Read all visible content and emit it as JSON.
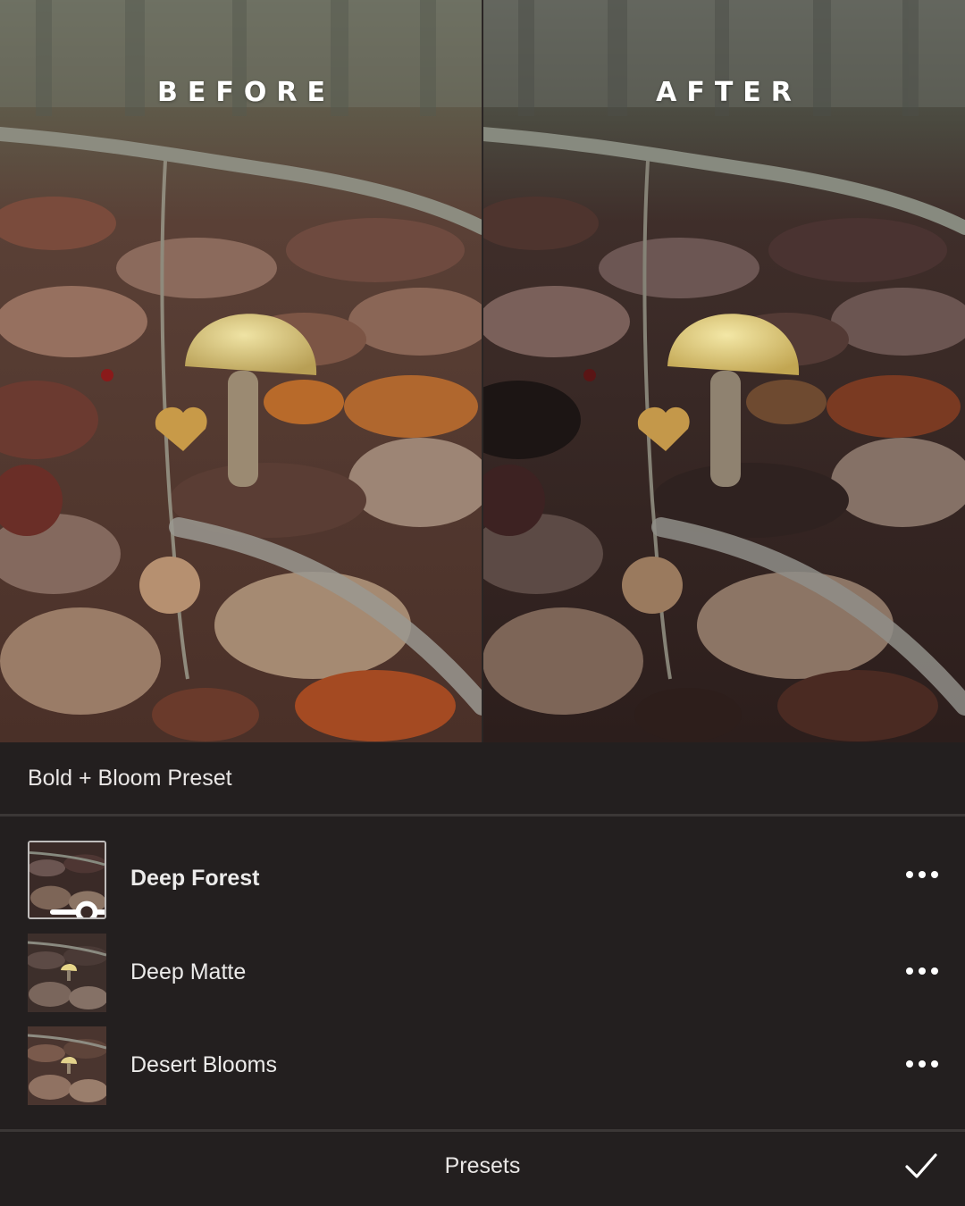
{
  "compare": {
    "before_label": "BEFORE",
    "after_label": "AFTER"
  },
  "panel": {
    "pack_title": "Bold + Bloom Preset",
    "presets": [
      {
        "name": "Deep Forest",
        "selected": true
      },
      {
        "name": "Deep Matte",
        "selected": false
      },
      {
        "name": "Desert Blooms",
        "selected": false
      }
    ],
    "footer_label": "Presets"
  },
  "icons": {
    "more": "more-dots-icon",
    "confirm": "checkmark-icon",
    "adjust": "slider-adjust-icon"
  },
  "colors": {
    "panel_bg": "#231f1f",
    "separator": "#3b3736",
    "text": "#ecebea"
  }
}
